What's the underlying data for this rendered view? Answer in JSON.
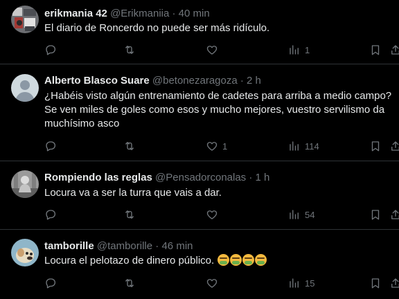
{
  "colors": {
    "background": "#000000",
    "text": "#e7e9ea",
    "muted": "#71767b",
    "divider": "#2f3336"
  },
  "tweets": [
    {
      "display_name": "erikmania 42",
      "handle": "@Erikmaniia",
      "dot": "·",
      "time": "40 min",
      "text": "El diario de Roncerdo no puede ser más ridículo.",
      "reply_count": "",
      "retweet_count": "",
      "like_count": "",
      "views_count": "1",
      "avatar_icon": "avatar-photo-collage"
    },
    {
      "display_name": "Alberto Blasco Suare",
      "handle": "@betonezaragoza",
      "dot": "·",
      "time": "2 h",
      "text": "¿Habéis visto algún entrenamiento de cadetes para arriba a medio campo?\nSe ven miles de goles como esos  y mucho mejores,  vuestro servilismo da\nmuchísimo asco",
      "reply_count": "",
      "retweet_count": "",
      "like_count": "1",
      "views_count": "114",
      "avatar_icon": "default-avatar"
    },
    {
      "display_name": "Rompiendo las reglas",
      "handle": "@Pensadorconalas",
      "dot": "·",
      "time": "1 h",
      "text": "Locura va a ser la turra que vais a dar.",
      "reply_count": "",
      "retweet_count": "",
      "like_count": "",
      "views_count": "54",
      "avatar_icon": "avatar-photo-statue"
    },
    {
      "display_name": "tamborille",
      "handle": "@tamborille",
      "dot": "·",
      "time": "46 min",
      "text": "Locura el pelotazo de dinero público.",
      "reply_count": "",
      "retweet_count": "",
      "like_count": "",
      "views_count": "15",
      "avatar_icon": "avatar-photo-animal",
      "emojis": [
        "nauseated-face",
        "nauseated-face",
        "nauseated-face",
        "nauseated-face"
      ]
    }
  ]
}
